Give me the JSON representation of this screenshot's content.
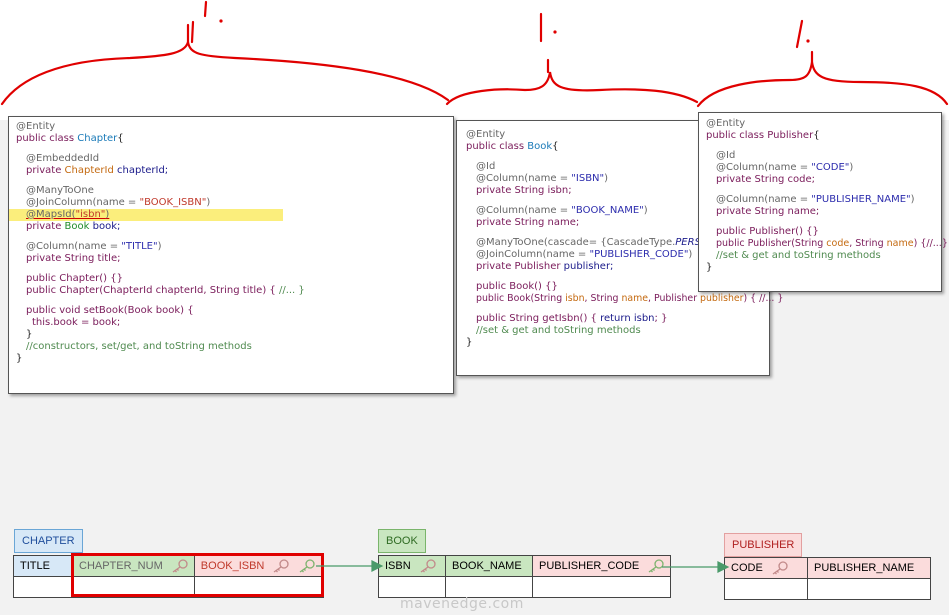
{
  "colors": {
    "annotation_red": "#e00000",
    "highlight": "#fbee7c",
    "chapter_label_bg": "#d7e8f7",
    "book_label_bg": "#c9e6c0",
    "publisher_label_bg": "#fbdcdc"
  },
  "annotations": {
    "count_chapter": "1.",
    "count_book": "1.",
    "count_publisher": "1."
  },
  "chapter_code": {
    "l1": "@Entity",
    "l2a": "public class ",
    "l2b": "Chapter",
    "l2c": "{",
    "l3": "@EmbeddedId",
    "l4a": "private ",
    "l4b": "ChapterId",
    "l4c": " chapterId;",
    "l5": "@ManyToOne",
    "l6a": "@JoinColumn(name = ",
    "l6b": "\"BOOK_ISBN\"",
    "l6c": ")",
    "l7a": "@MapsId(",
    "l7b": "\"isbn\"",
    "l7c": ")",
    "l8a": "private ",
    "l8b": "Book",
    "l8c": " book;",
    "l9a": "@Column(name = ",
    "l9b": "\"TITLE\"",
    "l9c": ")",
    "l10": "private String title;",
    "l11": "public Chapter() {}",
    "l12a": "public Chapter(ChapterId chapterId, String title) { ",
    "l12b": "//... }",
    "l13": "public void setBook(Book book) {",
    "l14": "this.book = book;",
    "l15": "}",
    "l16": "//constructors, set/get, and toString methods",
    "l17": "}"
  },
  "book_code": {
    "l1": "@Entity",
    "l2a": "public class ",
    "l2b": "Book",
    "l2c": "{",
    "l3": "@Id",
    "l4a": "@Column(name = ",
    "l4b": "\"ISBN\"",
    "l4c": ")",
    "l5": "private String isbn;",
    "l6a": "@Column(name = ",
    "l6b": "\"BOOK_NAME\"",
    "l6c": ")",
    "l7": "private String name;",
    "l8a": "@ManyToOne(cascade= {CascadeType.",
    "l8b": "PERSIST",
    "l8c": "})",
    "l9a": "@JoinColumn(name = ",
    "l9b": "\"PUBLISHER_CODE\"",
    "l9c": ")",
    "l10a": "private ",
    "l10b": "Publisher",
    "l10c": " publisher;",
    "l11": "public Book() {}",
    "l12a": "public Book(String ",
    "l12b": "isbn",
    "l12c": ", String ",
    "l12d": "name",
    "l12e": ", Publisher ",
    "l12f": "publisher",
    "l12g": ") { //... }",
    "l13a": "public String getIsbn() { ",
    "l13b": "return isbn",
    "l13c": "; }",
    "l14": "//set & get and toString methods",
    "l15": "}"
  },
  "publisher_code": {
    "l1": "@Entity",
    "l2a": "public class ",
    "l2b": "Publisher",
    "l2c": "{",
    "l3": "@Id",
    "l4a": "@Column(name = ",
    "l4b": "\"CODE\"",
    "l4c": ")",
    "l5": "private String code;",
    "l6a": "@Column(name = ",
    "l6b": "\"PUBLISHER_NAME\"",
    "l6c": ")",
    "l7": "private String name;",
    "l8": "public Publisher() {}",
    "l9a": "public Publisher(String ",
    "l9b": "code",
    "l9c": ", String ",
    "l9d": "name",
    "l9e": ") {//...}",
    "l10": "//set & get and toString methods",
    "l11": "}"
  },
  "tables": {
    "chapter": {
      "label": "CHAPTER",
      "cols": [
        "TITLE",
        "CHAPTER_NUM",
        "BOOK_ISBN"
      ]
    },
    "book": {
      "label": "BOOK",
      "cols": [
        "ISBN",
        "BOOK_NAME",
        "PUBLISHER_CODE"
      ]
    },
    "publisher": {
      "label": "PUBLISHER",
      "cols": [
        "CODE",
        "PUBLISHER_NAME"
      ]
    }
  },
  "icons": {
    "key": "key-icon",
    "arrow": "arrow-icon"
  },
  "watermark": "mavenedge.com"
}
